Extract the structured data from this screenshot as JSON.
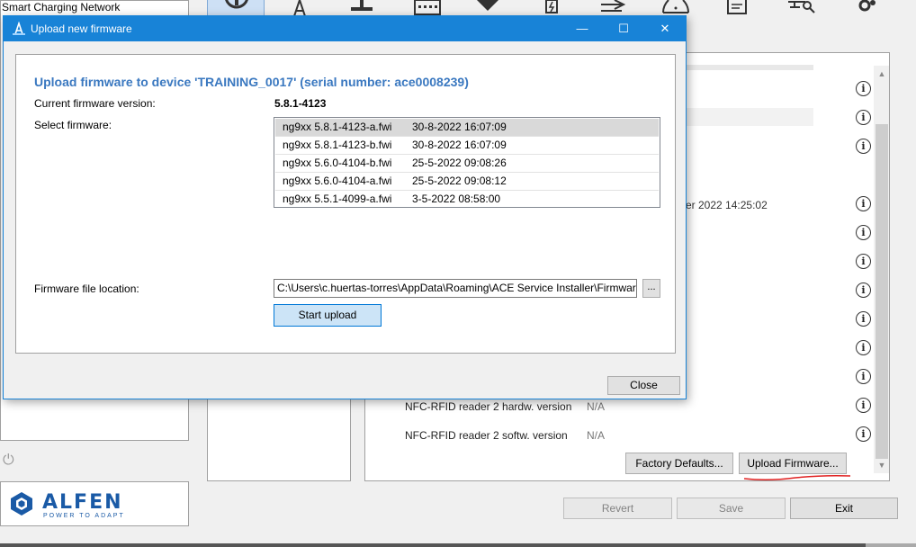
{
  "background": {
    "network_title": "Smart Charging Network",
    "date_fragment": "er 2022 14:25:02",
    "properties": [
      {
        "label": "NFC-RFID reader 2 hardw. version",
        "value": "N/A"
      },
      {
        "label": "NFC-RFID reader 2 softw. version",
        "value": "N/A"
      }
    ],
    "buttons": {
      "factory_defaults": "Factory Defaults...",
      "upload_firmware": "Upload Firmware...",
      "revert": "Revert",
      "save": "Save",
      "exit": "Exit"
    },
    "logo": {
      "name": "ALFEN",
      "tagline": "POWER TO ADAPT",
      "color": "#1a5aa6"
    },
    "toolbar_icons": [
      "info-icon",
      "pylon-icon",
      "meter-icon",
      "display-icon",
      "tag-icon",
      "charger-icon",
      "arrow-icon",
      "warning-icon",
      "document-icon",
      "network-icon",
      "gear-icon"
    ],
    "annotation_color": "#e02020"
  },
  "dialog": {
    "title": "Upload new firmware",
    "controls": {
      "minimize": "—",
      "maximize": "☐",
      "close": "✕"
    },
    "heading": "Upload firmware to device 'TRAINING_0017' (serial number: ace0008239)",
    "current_version_label": "Current firmware version:",
    "current_version": "5.8.1-4123",
    "select_label": "Select firmware:",
    "firmware_files": [
      {
        "name": "ng9xx 5.8.1-4123-a.fwi",
        "date": "30-8-2022 16:07:09",
        "selected": true
      },
      {
        "name": "ng9xx 5.8.1-4123-b.fwi",
        "date": "30-8-2022 16:07:09"
      },
      {
        "name": "ng9xx 5.6.0-4104-b.fwi",
        "date": "25-5-2022 09:08:26"
      },
      {
        "name": "ng9xx 5.6.0-4104-a.fwi",
        "date": "25-5-2022 09:08:12"
      },
      {
        "name": "ng9xx 5.5.1-4099-a.fwi",
        "date": "3-5-2022 08:58:00"
      }
    ],
    "location_label": "Firmware file location:",
    "location_value": "C:\\Users\\c.huertas-torres\\AppData\\Roaming\\ACE Service Installer\\Firmware\\",
    "browse_label": "...",
    "start_upload": "Start upload",
    "close": "Close",
    "accent_color": "#1883d7"
  }
}
